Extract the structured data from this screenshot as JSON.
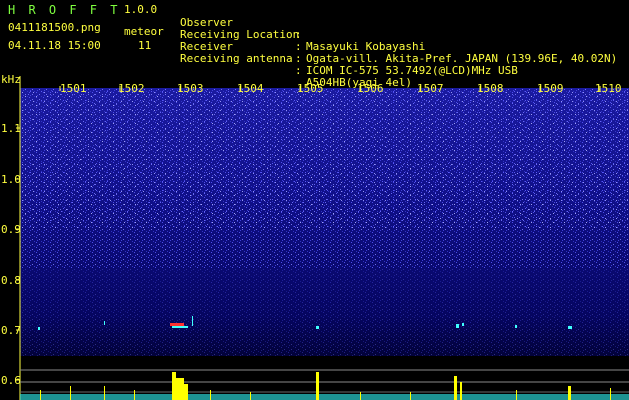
{
  "app": {
    "title_letters": "H R O F F T",
    "version": "1.0.0"
  },
  "file": {
    "filename": "0411181500.png",
    "datetime": "04.11.18 15:00",
    "meteor_label": "meteor",
    "meteor_count": "11"
  },
  "header": [
    {
      "label": "Observer",
      "value": "Masayuki Kobayashi"
    },
    {
      "label": "Receiving Location",
      "value": "Ogata-vill. Akita-Pref. JAPAN (139.96E, 40.02N)"
    },
    {
      "label": "Receiver",
      "value": "ICOM IC-575 53.7492(@LCD)MHz USB"
    },
    {
      "label": "Receiving antenna",
      "value": "A504HB(yagi 4el)"
    }
  ],
  "header_separator": ":",
  "axis": {
    "unit": "kHz",
    "time_ticks": [
      "1501",
      "1502",
      "1503",
      "1504",
      "1505",
      "1506",
      "1507",
      "1508",
      "1509",
      "1510"
    ],
    "freq_labels": [
      "1.1",
      "1.0",
      "0.9",
      "0.8",
      "0.7",
      "0.6"
    ]
  },
  "colors": {
    "title_green": "#7fff3f",
    "label_yellow": "#ffff3f",
    "background_blue": "#0a0a70",
    "signal_cyan": "#3fffff",
    "signal_yellow": "#ffff00",
    "signal_red": "#ff3030"
  }
}
